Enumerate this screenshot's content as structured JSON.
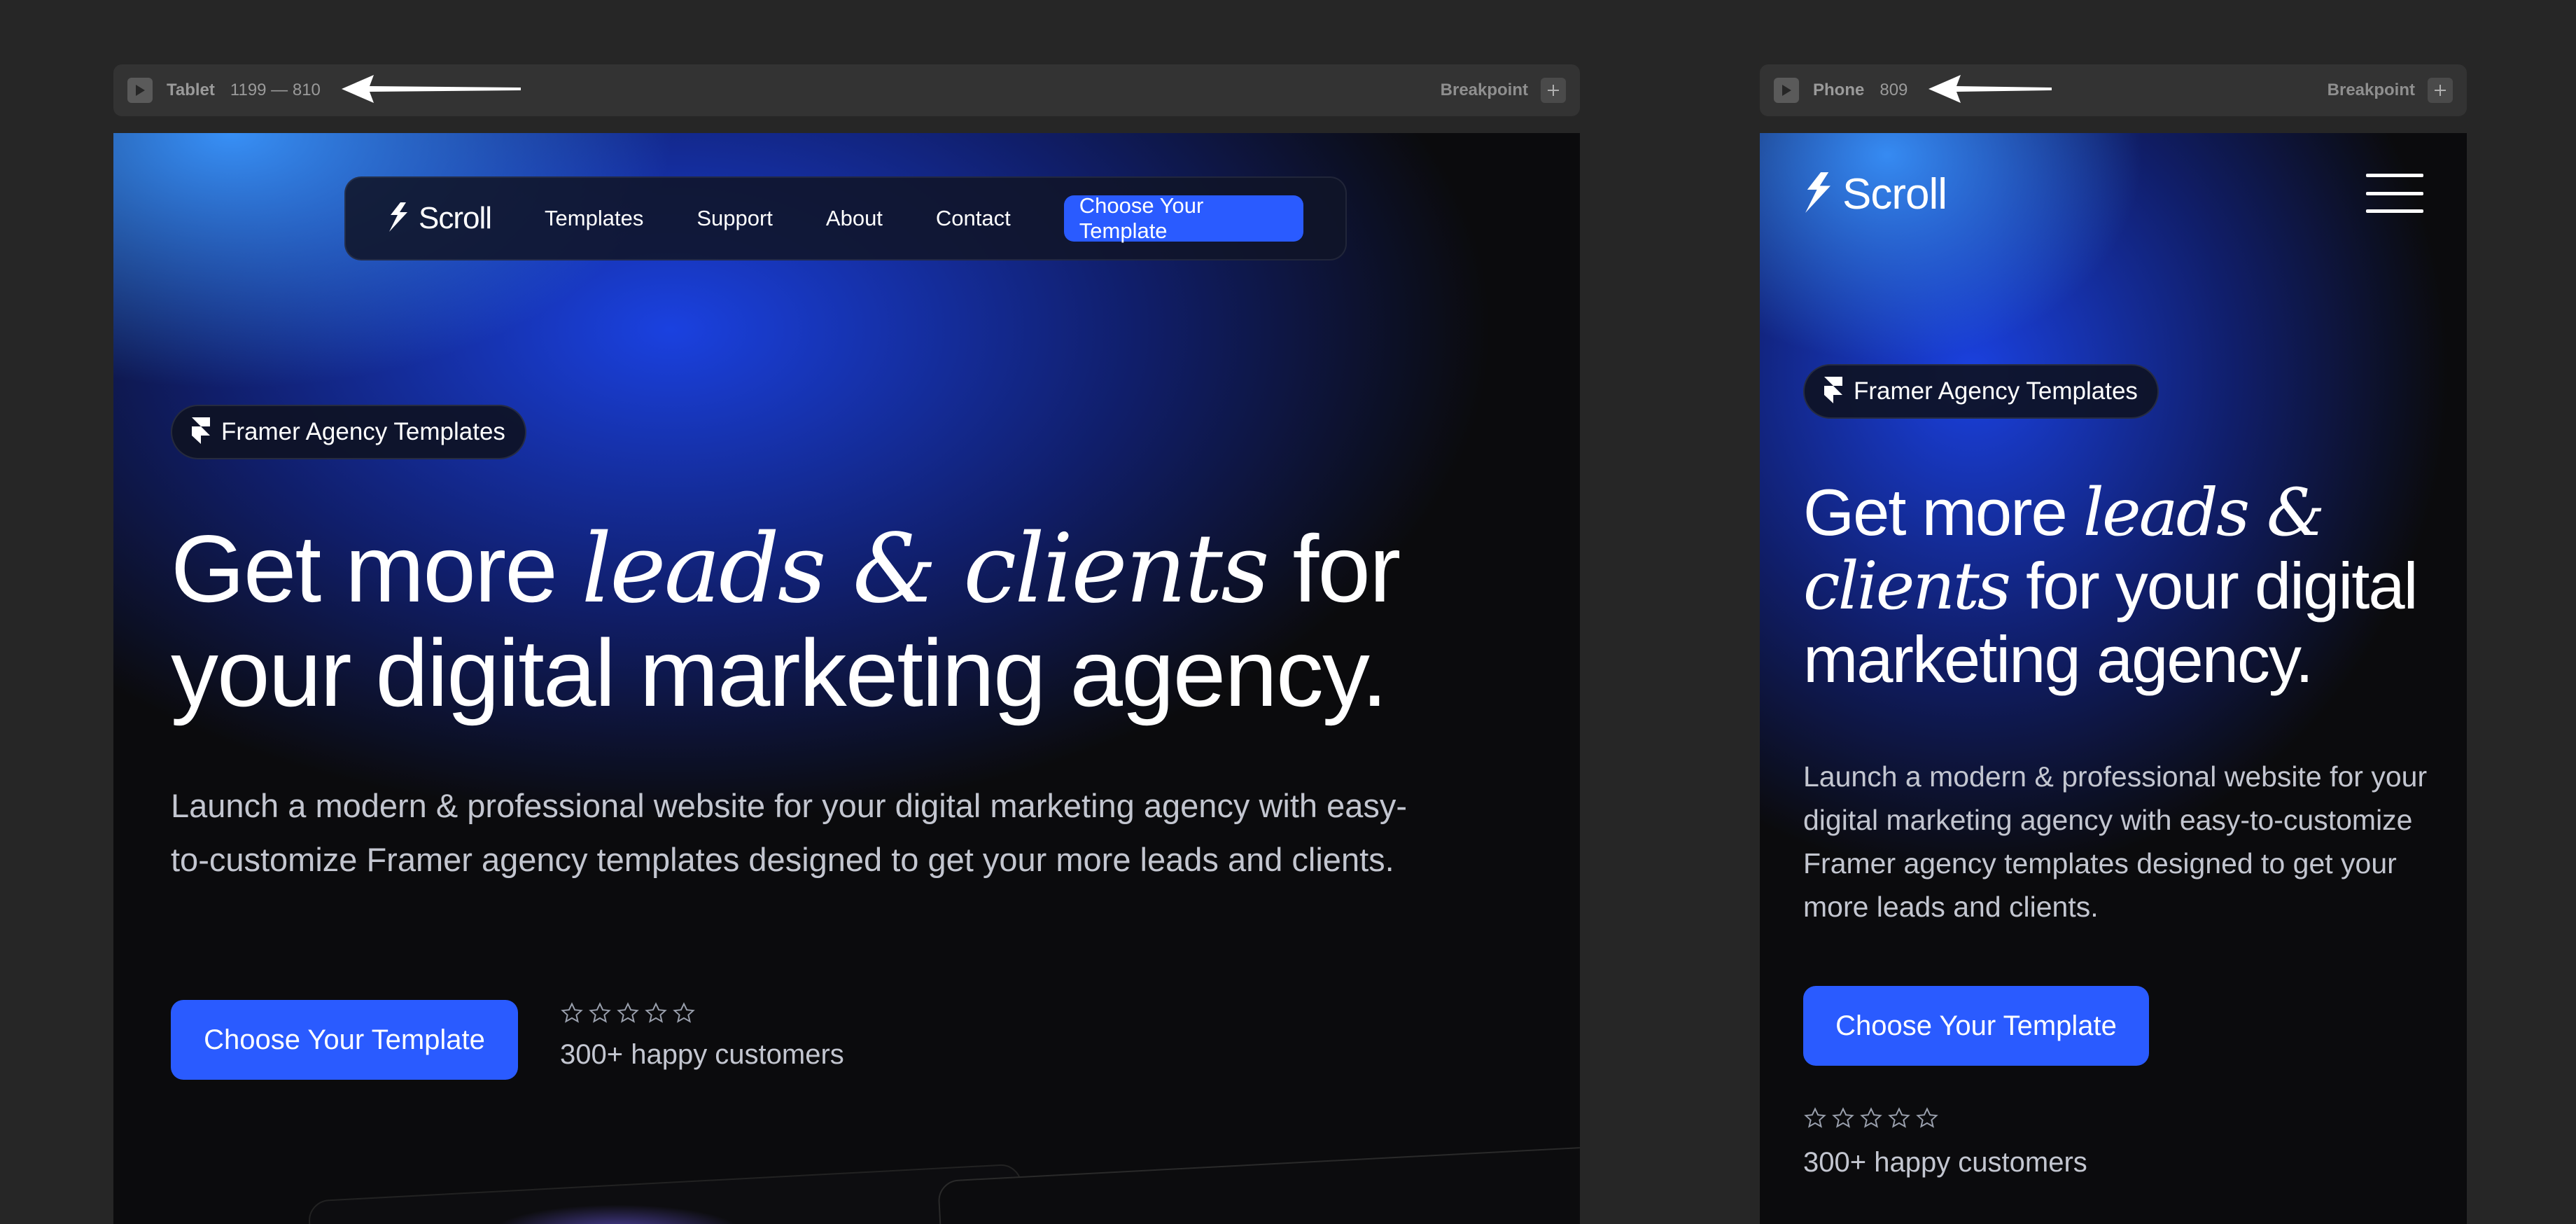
{
  "tablet_bar": {
    "name": "Tablet",
    "range": "1199 — 810",
    "breakpoint_label": "Breakpoint"
  },
  "phone_bar": {
    "name": "Phone",
    "range": "809",
    "breakpoint_label": "Breakpoint"
  },
  "brand": {
    "name": "Scroll"
  },
  "nav": {
    "links": [
      "Templates",
      "Support",
      "About",
      "Contact"
    ],
    "cta": "Choose Your Template"
  },
  "hero": {
    "badge": "Framer Agency Templates",
    "headline_pre": "Get more ",
    "headline_italic": "leads & clients",
    "headline_post": " for your digital marketing agency.",
    "subtext": "Launch a modern & professional website for your digital marketing agency with easy-to-customize Framer agency templates designed to get your more leads and clients.",
    "cta": "Choose Your Template",
    "rating_stars": 5,
    "customers": "300+ happy customers"
  },
  "colors": {
    "accent": "#2a5bff",
    "background": "#0b0b0d",
    "canvas": "#262626"
  },
  "icons": {
    "play": "play-icon",
    "add": "plus-icon",
    "logo": "bolt-icon",
    "badge": "framer-icon",
    "menu": "hamburger-icon",
    "star": "star-outline-icon"
  }
}
